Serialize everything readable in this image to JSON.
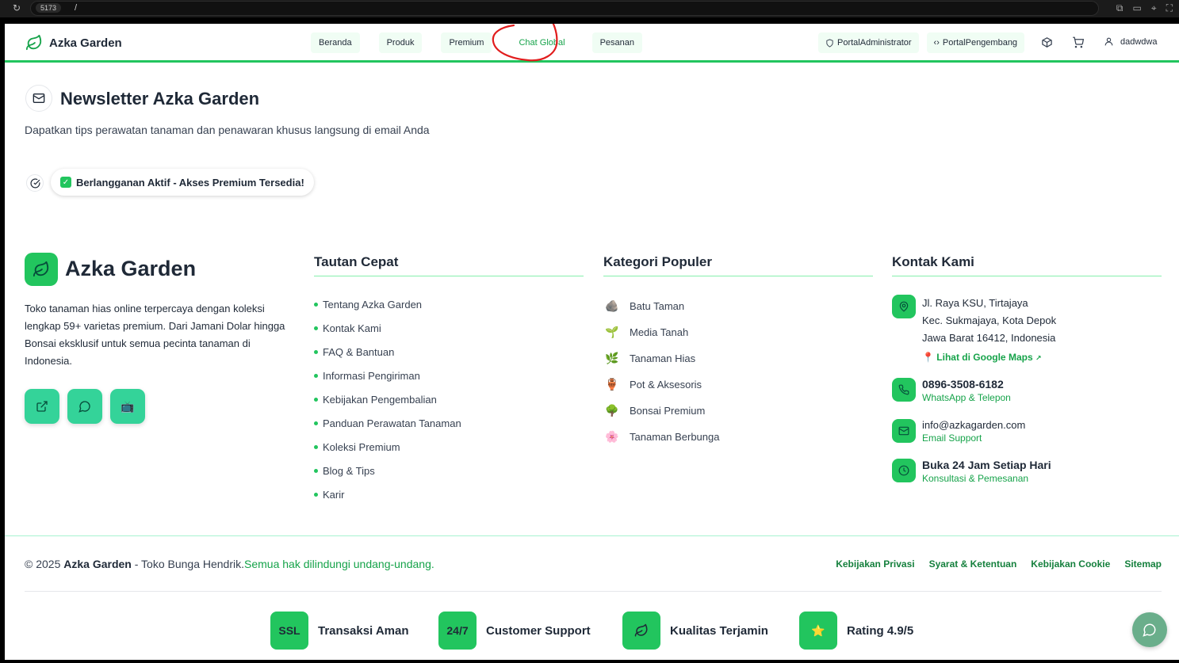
{
  "browser": {
    "port": "5173",
    "path": "/"
  },
  "nav": {
    "brand": "Azka Garden",
    "links": [
      "Beranda",
      "Produk",
      "Premium",
      "Chat Global",
      "Pesanan"
    ],
    "active_link": "Chat Global",
    "portal_admin": "PortalAdministrator",
    "portal_dev": "PortalPengembang",
    "username": "dadwdwa"
  },
  "newsletter": {
    "title": "Newsletter Azka Garden",
    "description": "Dapatkan tips perawatan tanaman dan penawaran khusus langsung di email Anda",
    "status_badge": "Berlangganan Aktif - Akses Premium Tersedia!"
  },
  "footer": {
    "brand": "Azka Garden",
    "about": "Toko tanaman hias online terpercaya dengan koleksi lengkap 59+ varietas premium. Dari Jamani Dolar hingga Bonsai eksklusif untuk semua pecinta tanaman di Indonesia.",
    "quick_links_title": "Tautan Cepat",
    "quick_links": [
      "Tentang Azka Garden",
      "Kontak Kami",
      "FAQ & Bantuan",
      "Informasi Pengiriman",
      "Kebijakan Pengembalian",
      "Panduan Perawatan Tanaman",
      "Koleksi Premium",
      "Blog & Tips",
      "Karir"
    ],
    "categories_title": "Kategori Populer",
    "categories": [
      {
        "icon": "🪨",
        "label": "Batu Taman"
      },
      {
        "icon": "🌱",
        "label": "Media Tanah"
      },
      {
        "icon": "🌿",
        "label": "Tanaman Hias"
      },
      {
        "icon": "🏺",
        "label": "Pot & Aksesoris"
      },
      {
        "icon": "🌳",
        "label": "Bonsai Premium"
      },
      {
        "icon": "🌸",
        "label": "Tanaman Berbunga"
      }
    ],
    "contact_title": "Kontak Kami",
    "address_line1": "Jl. Raya KSU, Tirtajaya",
    "address_line2": "Kec. Sukmajaya, Kota Depok",
    "address_line3": "Jawa Barat 16412, Indonesia",
    "maps_link": "Lihat di Google Maps",
    "phone": "0896-3508-6182",
    "phone_sub": "WhatsApp & Telepon",
    "email": "info@azkagarden.com",
    "email_sub": "Email Support",
    "hours": "Buka 24 Jam Setiap Hari",
    "hours_sub": "Konsultasi & Pemesanan"
  },
  "bottom": {
    "copyright_prefix": "© 2025",
    "copyright_brand": "Azka Garden",
    "copyright_mid": "- Toko Bunga Hendrik.",
    "copyright_rights": "Semua hak dilindungi undang-undang.",
    "legal_links": [
      "Kebijakan Privasi",
      "Syarat & Ketentuan",
      "Kebijakan Cookie",
      "Sitemap"
    ],
    "trust": [
      {
        "badge": "SSL",
        "label": "Transaksi Aman"
      },
      {
        "badge": "24/7",
        "label": "Customer Support"
      },
      {
        "badge": "",
        "label": "Kualitas Terjamin"
      },
      {
        "badge": "⭐",
        "label": "Rating 4.9/5"
      }
    ]
  },
  "colors": {
    "accent": "#22c55e",
    "accent_dark": "#16a34a",
    "annotation": "#e11d1d"
  }
}
